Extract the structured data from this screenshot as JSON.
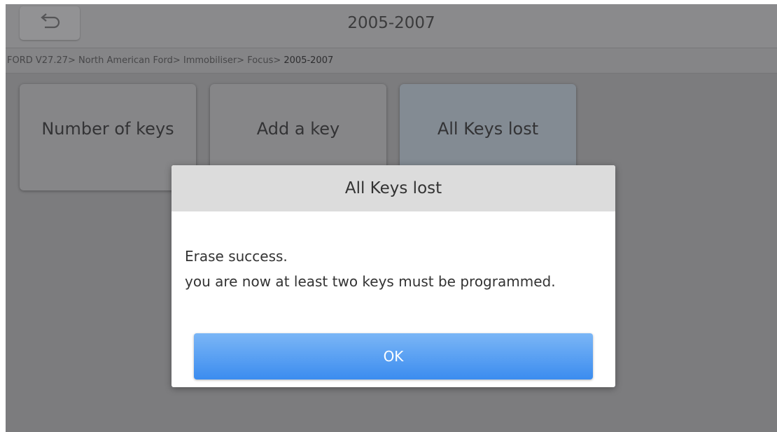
{
  "header": {
    "title": "2005-2007",
    "back_icon": "back-arrow-icon"
  },
  "breadcrumb": {
    "path": "FORD V27.27> North American Ford> Immobiliser> Focus> ",
    "current": "2005-2007"
  },
  "menu": {
    "items": [
      {
        "label": "Number of keys"
      },
      {
        "label": "Add a key"
      },
      {
        "label": "All Keys lost"
      }
    ]
  },
  "dialog": {
    "title": "All Keys lost",
    "message_line1": "Erase success.",
    "message_line2": "you are now at least two keys must be programmed.",
    "ok_label": "OK"
  },
  "colors": {
    "overlay_background": "#7c7c7e",
    "dialog_header": "#dcdcdc",
    "ok_button": "#3b8cef"
  }
}
